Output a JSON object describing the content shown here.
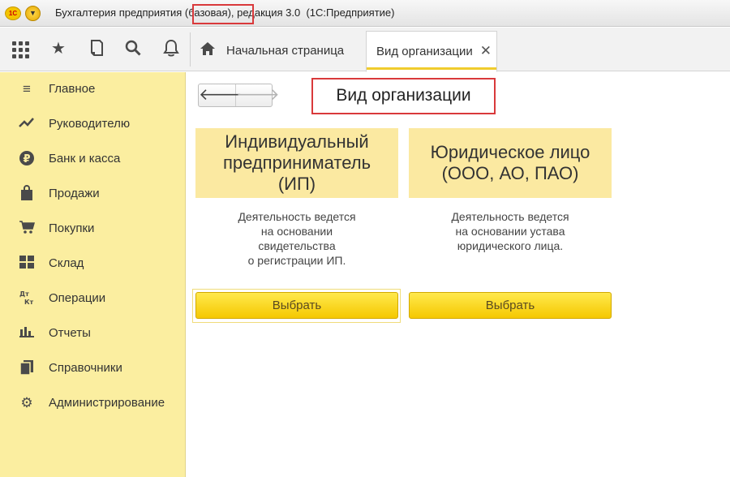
{
  "titlebar": {
    "title": "Бухгалтерия предприятия (базовая), редакция 3.0  (1С:Предприятие)",
    "logo_text": "1С"
  },
  "toolbar": {
    "icons": [
      "apps-grid-icon",
      "star-icon",
      "history-icon",
      "search-icon",
      "bell-icon"
    ],
    "tabs": [
      {
        "label": "Начальная страница",
        "icon": "home-icon"
      },
      {
        "label": "Вид организации",
        "close": "✕"
      }
    ]
  },
  "sidebar": {
    "items": [
      {
        "label": "Главное",
        "icon": "menu-lines-icon"
      },
      {
        "label": "Руководителю",
        "icon": "trend-icon"
      },
      {
        "label": "Банк и касса",
        "icon": "ruble-icon"
      },
      {
        "label": "Продажи",
        "icon": "bag-icon"
      },
      {
        "label": "Покупки",
        "icon": "cart-icon"
      },
      {
        "label": "Склад",
        "icon": "warehouse-icon"
      },
      {
        "label": "Операции",
        "icon": "dt-kt-icon"
      },
      {
        "label": "Отчеты",
        "icon": "bar-chart-icon"
      },
      {
        "label": "Справочники",
        "icon": "books-icon"
      },
      {
        "label": "Администрирование",
        "icon": "gear-icon"
      }
    ]
  },
  "main": {
    "page_title": "Вид организации",
    "nav": {
      "back": "🡐",
      "forward": "🡒"
    },
    "cards": [
      {
        "title": "Индивидуальный\nпредприниматель\n(ИП)",
        "description": "Деятельность ведется\nна основании\nсвидетельства\nо регистрации ИП.",
        "button": "Выбрать"
      },
      {
        "title": "Юридическое лицо\n(ООО, АО, ПАО)",
        "description": "Деятельность ведется\nна основании устава\nюридического лица.",
        "button": "Выбрать"
      }
    ]
  },
  "colors": {
    "sidebar_bg": "#fbeea0",
    "card_head_bg": "#fbe9a1",
    "button_yellow": "#f5c800",
    "highlight_red": "#d9393b",
    "tab_underline": "#f0cc2d"
  }
}
